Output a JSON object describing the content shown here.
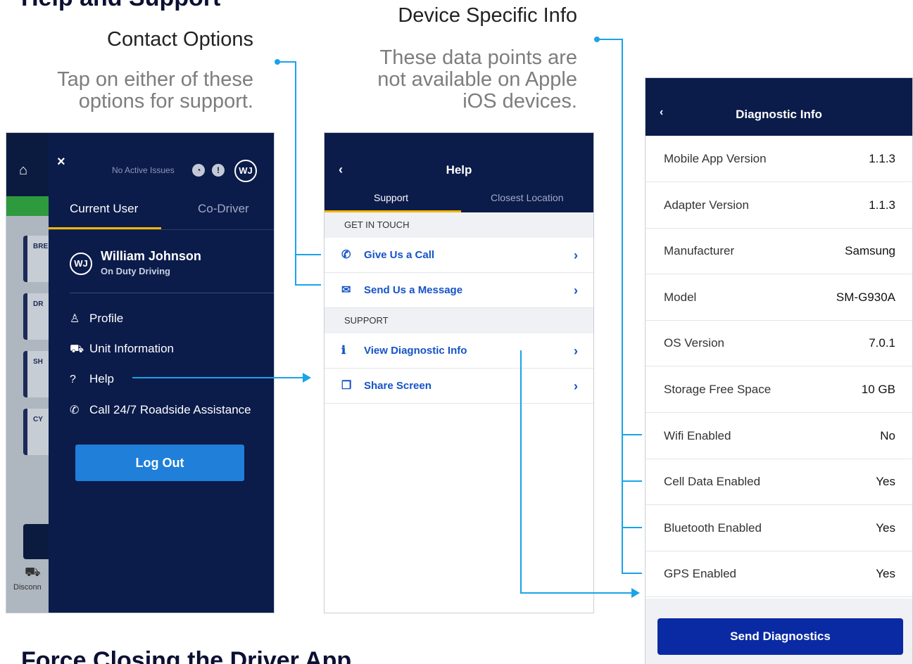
{
  "headings": {
    "top": "Help and Support",
    "bottom": "Force Closing the Driver App"
  },
  "callouts": {
    "contact": {
      "title": "Contact Options",
      "line1": "Tap on either of these",
      "line2": "options for support."
    },
    "device": {
      "title": "Device Specific Info",
      "line1": "These data points are",
      "line2": "not available on Apple",
      "line3": "iOS devices."
    }
  },
  "drawer_screen": {
    "background": {
      "cards": [
        "BRE",
        "DR",
        "SH",
        "CY"
      ],
      "disconnect_label": "Disconn"
    },
    "close_label": "×",
    "no_active_issues": "No Active Issues",
    "avatar_initials": "WJ",
    "tabs": [
      "Current User",
      "Co-Driver"
    ],
    "user": {
      "initials": "WJ",
      "name": "William Johnson",
      "status": "On Duty Driving"
    },
    "menu": [
      {
        "icon": "person-icon",
        "label": "Profile"
      },
      {
        "icon": "truck-icon",
        "label": "Unit Information"
      },
      {
        "icon": "help-icon",
        "label": "Help"
      },
      {
        "icon": "phone-icon",
        "label": "Call 24/7 Roadside Assistance"
      }
    ],
    "logout_label": "Log Out"
  },
  "help_screen": {
    "back": "‹",
    "title": "Help",
    "tabs": [
      "Support",
      "Closest Location"
    ],
    "sections": {
      "get_in_touch": "GET IN TOUCH",
      "support": "SUPPORT"
    },
    "rows": {
      "call": "Give Us a Call",
      "message": "Send Us a Message",
      "diagnostic": "View Diagnostic Info",
      "share": "Share Screen"
    },
    "chevron": "›"
  },
  "diagnostic_screen": {
    "back": "‹",
    "title": "Diagnostic Info",
    "rows": [
      {
        "key": "Mobile App Version",
        "value": "1.1.3"
      },
      {
        "key": "Adapter Version",
        "value": "1.1.3"
      },
      {
        "key": "Manufacturer",
        "value": "Samsung"
      },
      {
        "key": "Model",
        "value": "SM-G930A"
      },
      {
        "key": "OS Version",
        "value": "7.0.1"
      },
      {
        "key": "Storage Free Space",
        "value": "10 GB"
      },
      {
        "key": "Wifi Enabled",
        "value": "No"
      },
      {
        "key": "Cell Data Enabled",
        "value": "Yes"
      },
      {
        "key": "Bluetooth Enabled",
        "value": "Yes"
      },
      {
        "key": "GPS Enabled",
        "value": "Yes"
      }
    ],
    "send_label": "Send Diagnostics"
  },
  "colors": {
    "navy": "#0b1b4a",
    "accent_yellow": "#f5b400",
    "link_blue": "#1553c7",
    "callout_line": "#1aa3e8",
    "logout_blue": "#1f7fd9",
    "send_blue": "#0a2aa3"
  }
}
